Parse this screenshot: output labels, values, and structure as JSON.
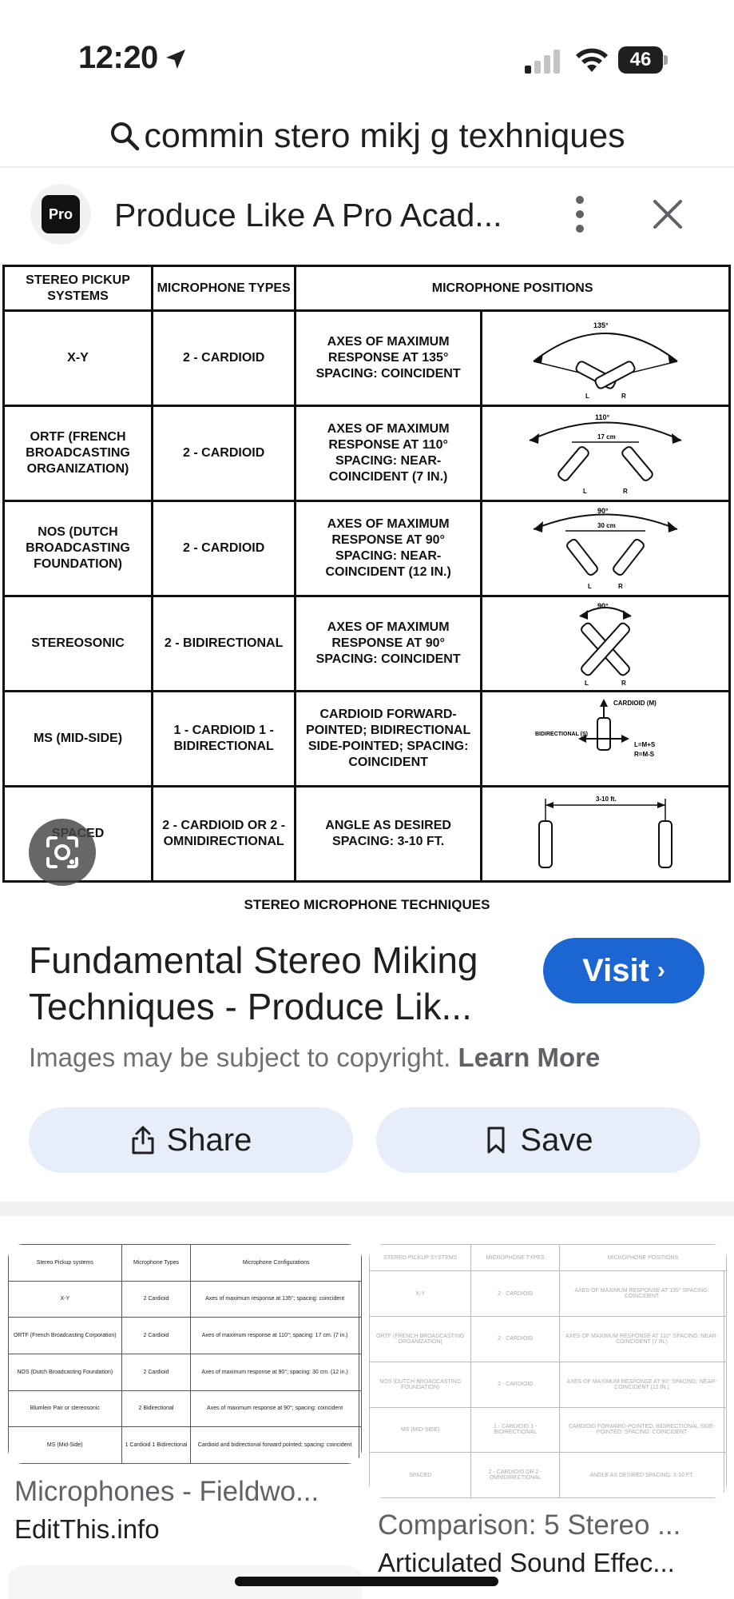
{
  "status": {
    "time": "12:20",
    "battery": "46"
  },
  "query": {
    "text": "commin stero mikj g texhniques"
  },
  "source": {
    "favicon_text": "Pro",
    "name": "Produce Like A Pro Acad..."
  },
  "technique_table": {
    "headers": [
      "STEREO PICKUP SYSTEMS",
      "MICROPHONE TYPES",
      "MICROPHONE POSITIONS"
    ],
    "rows": [
      {
        "system": "X-Y",
        "types": "2 - CARDIOID",
        "positions": "AXES OF MAXIMUM RESPONSE AT 135° SPACING: COINCIDENT",
        "angle": "135°",
        "spacing": ""
      },
      {
        "system": "ORTF (FRENCH BROADCASTING ORGANIZATION)",
        "types": "2 - CARDIOID",
        "positions": "AXES OF MAXIMUM RESPONSE AT 110° SPACING: NEAR-COINCIDENT (7 IN.)",
        "angle": "110°",
        "spacing": "17 cm"
      },
      {
        "system": "NOS (DUTCH BROADCASTING FOUNDATION)",
        "types": "2 - CARDIOID",
        "positions": "AXES OF MAXIMUM RESPONSE AT 90° SPACING: NEAR-COINCIDENT (12 IN.)",
        "angle": "90°",
        "spacing": "30 cm"
      },
      {
        "system": "STEREOSONIC",
        "types": "2 - BIDIRECTIONAL",
        "positions": "AXES OF MAXIMUM RESPONSE AT 90° SPACING: COINCIDENT",
        "angle": "90°",
        "spacing": ""
      },
      {
        "system": "MS (MID-SIDE)",
        "types": "1 - CARDIOID 1 - BIDIRECTIONAL",
        "positions": "CARDIOID FORWARD-POINTED; BIDIRECTIONAL SIDE-POINTED; SPACING: COINCIDENT",
        "angle": "",
        "spacing": ""
      },
      {
        "system": "SPACED",
        "types": "2 - CARDIOID OR 2 - OMNIDIRECTIONAL",
        "positions": "ANGLE AS DESIRED SPACING: 3-10 FT.",
        "angle": "",
        "spacing": "3-10 ft."
      }
    ],
    "ms_labels": {
      "cardioid": "CARDIOID (M)",
      "bidirectional": "BIDIRECTIONAL (S)",
      "sum": "L=M+S",
      "diff": "R=M-S"
    },
    "mic_left": "L",
    "mic_right": "R",
    "caption": "STEREO MICROPHONE TECHNIQUES"
  },
  "result": {
    "title": "Fundamental Stereo Miking Techniques - Produce Lik...",
    "visit_label": "Visit",
    "copyright": "Images may be subject to copyright.",
    "learn_more": "Learn More",
    "share_label": "Share",
    "save_label": "Save"
  },
  "related": [
    {
      "title": "Microphones - Fieldwo...",
      "site": "EditThis.info",
      "headers": [
        "Stereo Pickup systems",
        "Microphone Types",
        "Microphone Configurations"
      ],
      "rows": [
        [
          "X-Y",
          "2 Cardioid",
          "Axes of maximum response at 135°; spacing: coincident"
        ],
        [
          "ORTF (French Broadcasting Corporation)",
          "2 Cardioid",
          "Axes of maximum response at 110°; spacing: 17 cm. (7 in.)"
        ],
        [
          "NOS (Dutch Broadcasting Foundation)",
          "2 Cardioid",
          "Axes of maximum response at 90°; spacing: 30 cm. (12 in.)"
        ],
        [
          "Blumlein Pair or stereosonic",
          "2 Bidirectional",
          "Axes of maximum response at 90°; spacing: coincident"
        ],
        [
          "MS (Mid-Side)",
          "1 Cardioid 1 Bidirectional",
          "Cardioid and bidirectional forward pointed; spacing: coincident"
        ]
      ]
    },
    {
      "title": "Comparison: 5 Stereo ...",
      "site": "Articulated Sound Effec...",
      "headers": [
        "STEREO PICKUP SYSTEMS",
        "MICROPHONE TYPES",
        "MICROPHONE POSITIONS"
      ],
      "rows": [
        [
          "X-Y",
          "2 - CARDIOID",
          "AXES OF MAXIMUM RESPONSE AT 135° SPACING: COINCIDENT"
        ],
        [
          "ORTF (FRENCH BROADCASTING ORGANIZATION)",
          "2 - CARDIOID",
          "AXES OF MAXIMUM RESPONSE AT 110° SPACING: NEAR-COINCIDENT (7 IN.)"
        ],
        [
          "NOS (DUTCH BROADCASTING FOUNDATION)",
          "2 - CARDIOID",
          "AXES OF MAXIMUM RESPONSE AT 90° SPACING: NEAR-COINCIDENT (12 IN.)"
        ],
        [
          "MS (MID-SIDE)",
          "1 - CARDIOID 1 - BIDIRECTIONAL",
          "CARDIOID FORWARD-POINTED; BIDIRECTIONAL SIDE-POINTED; SPACING: COINCIDENT"
        ],
        [
          "SPACED",
          "2 - CARDIOID OR 2 - OMNIDIRECTIONAL",
          "ANGLE AS DESIRED SPACING: 3-10 FT."
        ]
      ]
    }
  ],
  "colors": {
    "accent": "#1b66d3",
    "chip_bg": "#e8eef9",
    "muted_text": "#707070"
  },
  "icons": [
    "location-arrow-icon",
    "signal-icon",
    "wifi-icon",
    "battery-icon",
    "search-icon",
    "more-vert-icon",
    "close-icon",
    "lens-icon",
    "share-icon",
    "bookmark-icon",
    "chevron-right-icon"
  ]
}
